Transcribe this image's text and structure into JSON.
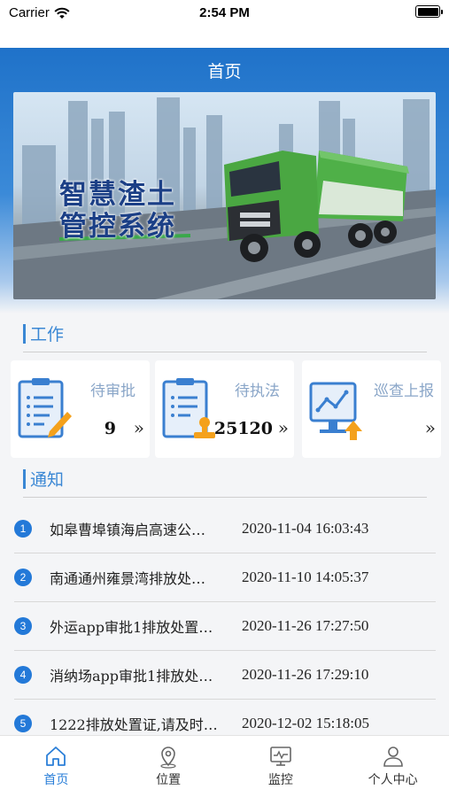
{
  "status": {
    "carrier": "Carrier",
    "time": "2:54 PM"
  },
  "header": {
    "title": "首页"
  },
  "banner": {
    "line1": "智慧渣土",
    "line2": "管控系统"
  },
  "sections": {
    "work": "工作",
    "notice": "通知"
  },
  "cards": [
    {
      "label": "待审批",
      "count": "9",
      "arrow": "»"
    },
    {
      "label": "待执法",
      "count": "25120",
      "arrow": "»"
    },
    {
      "label": "巡查上报",
      "count": "",
      "arrow": "»"
    }
  ],
  "notices": [
    {
      "num": "1",
      "text": "如皋曹埠镇海启高速公…",
      "date": "2020-11-04 16:03:43"
    },
    {
      "num": "2",
      "text": "南通通州雍景湾排放处…",
      "date": "2020-11-10 14:05:37"
    },
    {
      "num": "3",
      "text": "外运app审批1排放处置…",
      "date": "2020-11-26 17:27:50"
    },
    {
      "num": "4",
      "text": "消纳场app审批1排放处…",
      "date": "2020-11-26 17:29:10"
    },
    {
      "num": "5",
      "text": "1222排放处置证,请及时…",
      "date": "2020-12-02 15:18:05"
    }
  ],
  "tabs": [
    {
      "label": "首页",
      "icon": "home-icon",
      "active": true
    },
    {
      "label": "位置",
      "icon": "location-pin-icon",
      "active": false
    },
    {
      "label": "监控",
      "icon": "monitor-icon",
      "active": false
    },
    {
      "label": "个人中心",
      "icon": "person-icon",
      "active": false
    }
  ],
  "colors": {
    "accent": "#2b7fd8",
    "header": "#1f72c9",
    "badge": "#2379d8",
    "card_label": "#8aa6c8"
  }
}
